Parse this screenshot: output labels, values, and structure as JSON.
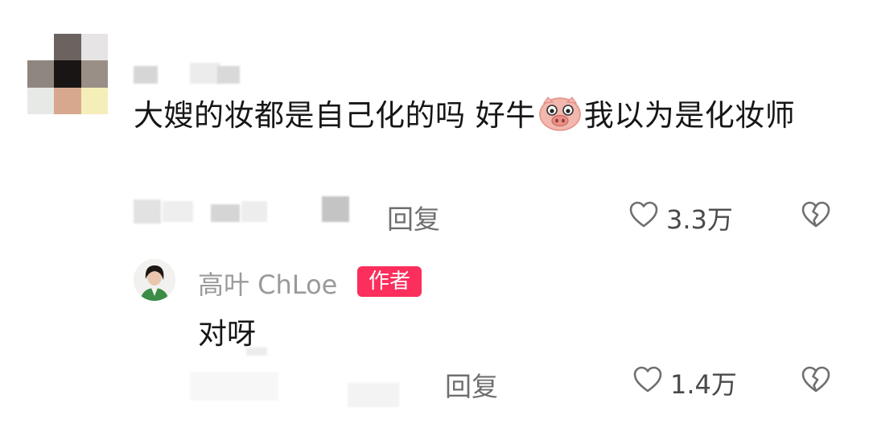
{
  "comment": {
    "username": "",
    "text_prefix": "大嫂的妆都是自己化的吗 好牛",
    "emoji": "pig-face-emoji",
    "text_suffix": "我以为是化妆师",
    "reply_label": "回复",
    "like_count": "3.3万"
  },
  "author_reply": {
    "username": "高叶 ChLoe",
    "badge": "作者",
    "text": "对呀",
    "reply_label": "回复",
    "like_count": "1.4万"
  },
  "colors": {
    "badge": "#fb2e5c",
    "text": "#161616",
    "muted": "#9a9a9a",
    "icon": "#6f6f6f"
  },
  "icons": [
    "heart-icon",
    "broken-heart-icon"
  ]
}
